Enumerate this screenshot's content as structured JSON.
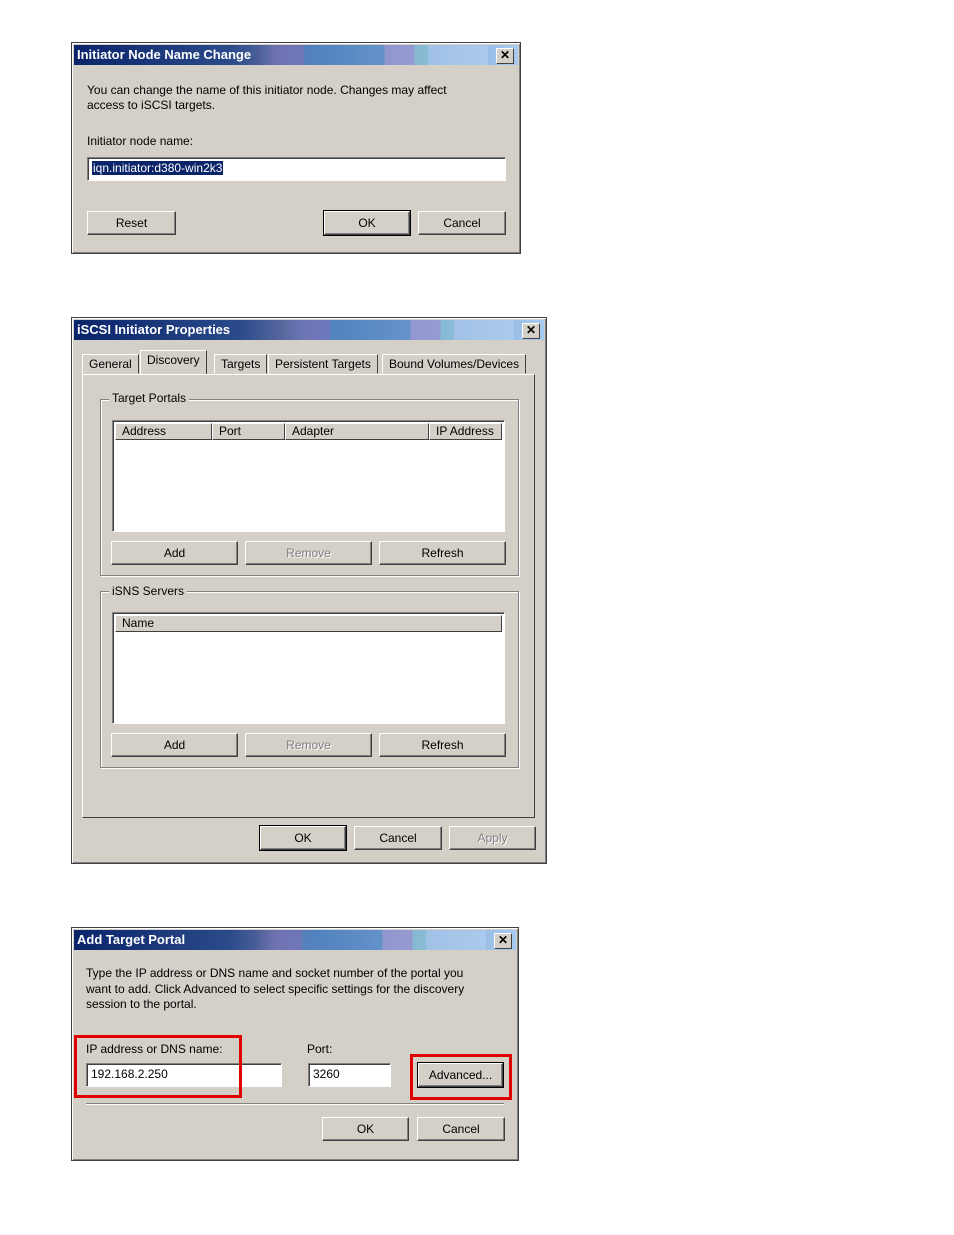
{
  "dialog1": {
    "title": "Initiator Node Name Change",
    "description_line1": "You can change the name of this initiator node.  Changes may affect",
    "description_line2": "access to iSCSI targets.",
    "name_label": "Initiator node name:",
    "name_value": "iqn.initiator:d380-win2k3",
    "reset_label": "Reset",
    "ok_label": "OK",
    "cancel_label": "Cancel"
  },
  "dialog2": {
    "title": "iSCSI Initiator Properties",
    "tabs": [
      "General",
      "Discovery",
      "Targets",
      "Persistent Targets",
      "Bound Volumes/Devices"
    ],
    "active_tab": "Discovery",
    "target_portals": {
      "title": "Target Portals",
      "columns": [
        "Address",
        "Port",
        "Adapter",
        "IP Address"
      ],
      "add_label": "Add",
      "remove_label": "Remove",
      "refresh_label": "Refresh"
    },
    "isns_servers": {
      "title": "iSNS Servers",
      "columns": [
        "Name"
      ],
      "add_label": "Add",
      "remove_label": "Remove",
      "refresh_label": "Refresh"
    },
    "ok_label": "OK",
    "cancel_label": "Cancel",
    "apply_label": "Apply"
  },
  "dialog3": {
    "title": "Add Target Portal",
    "description_line1": "Type the IP address or DNS name and socket number of the portal you",
    "description_line2": "want to add. Click Advanced to select specific settings for the discovery",
    "description_line3": "session to the portal.",
    "ip_label": "IP address or DNS name:",
    "ip_value": "192.168.2.250",
    "port_label": "Port:",
    "port_value": "3260",
    "advanced_label": "Advanced...",
    "ok_label": "OK",
    "cancel_label": "Cancel"
  },
  "colors": {
    "highlight": "#e00000",
    "titlebar": "#0a246a",
    "face": "#d4d0c8"
  }
}
